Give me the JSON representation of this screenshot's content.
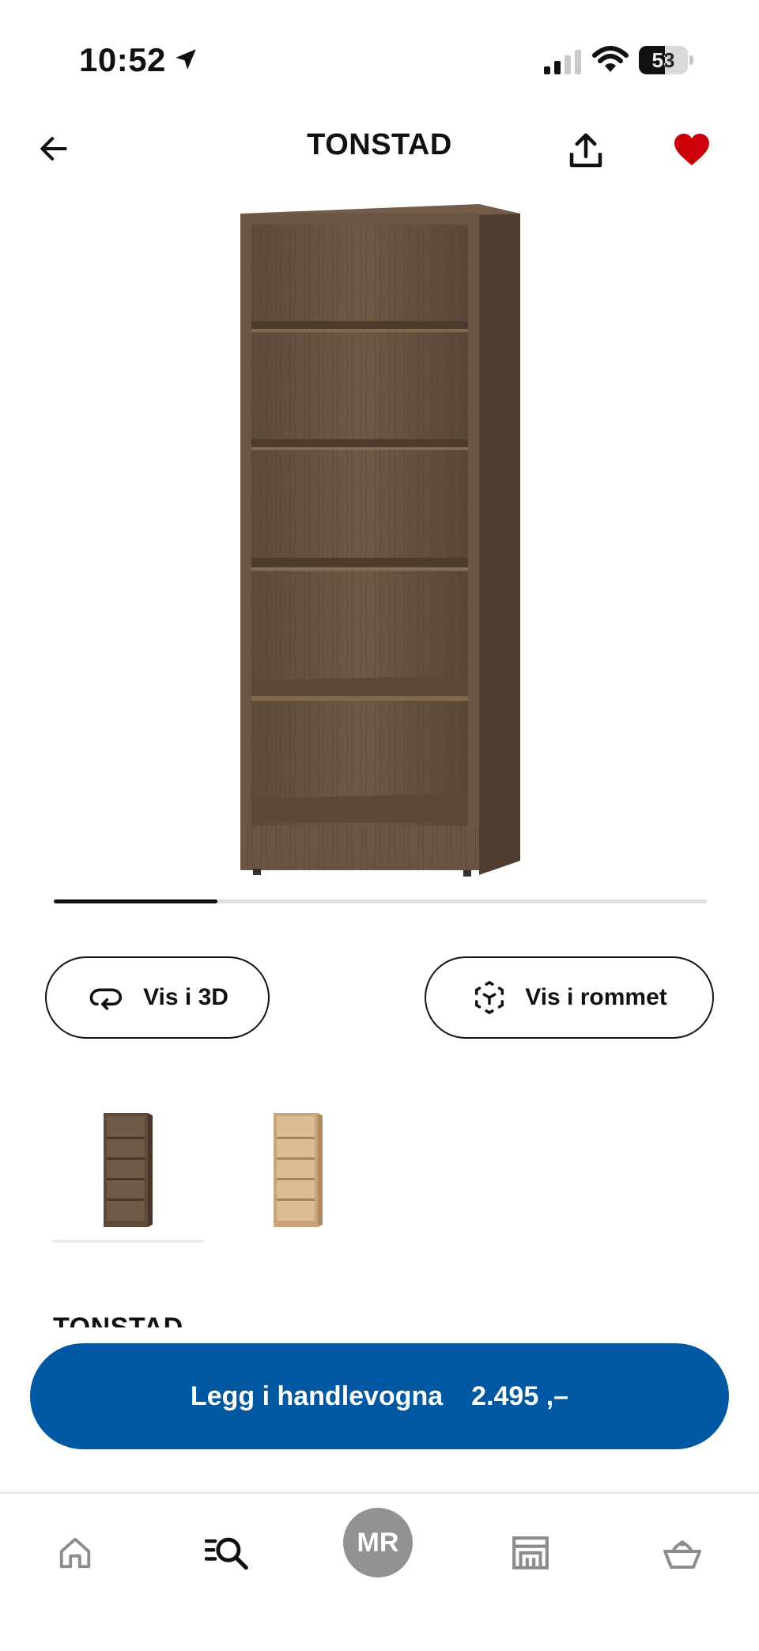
{
  "status_bar": {
    "time": "10:52",
    "battery_level": "53",
    "battery_fraction": 0.53,
    "icons": [
      "location-arrow-icon",
      "signal-icon",
      "wifi-icon",
      "battery-icon"
    ]
  },
  "header": {
    "title": "TONSTAD",
    "back_icon": "arrow-left-icon",
    "share_icon": "share-icon",
    "favorite_icon": "heart-icon",
    "favorite_active": true,
    "favorite_color": "#cc0008"
  },
  "product": {
    "image": "bookcase-brown-oak-image",
    "carousel_progress": 0.25,
    "name_partial": "TONSTAD"
  },
  "actions": {
    "view_3d_label": "Vis i 3D",
    "view_3d_icon": "rotate-3d-icon",
    "view_room_label": "Vis i rommet",
    "view_room_icon": "ar-cube-icon"
  },
  "variants": [
    {
      "name": "brown-oak-variant",
      "selected": true,
      "color": "#6b5440"
    },
    {
      "name": "light-oak-variant",
      "selected": false,
      "color": "#d9b68a"
    }
  ],
  "cart": {
    "label": "Legg i handlevogna",
    "price": "2.495 ,–",
    "color": "#0058a3"
  },
  "bottom_nav": {
    "items": [
      "home-icon",
      "search-icon",
      "profile-avatar",
      "store-icon",
      "basket-icon"
    ],
    "profile_initials": "MR"
  },
  "colors": {
    "accent": "#0058a3",
    "favorite": "#cc0008",
    "text": "#111111"
  }
}
